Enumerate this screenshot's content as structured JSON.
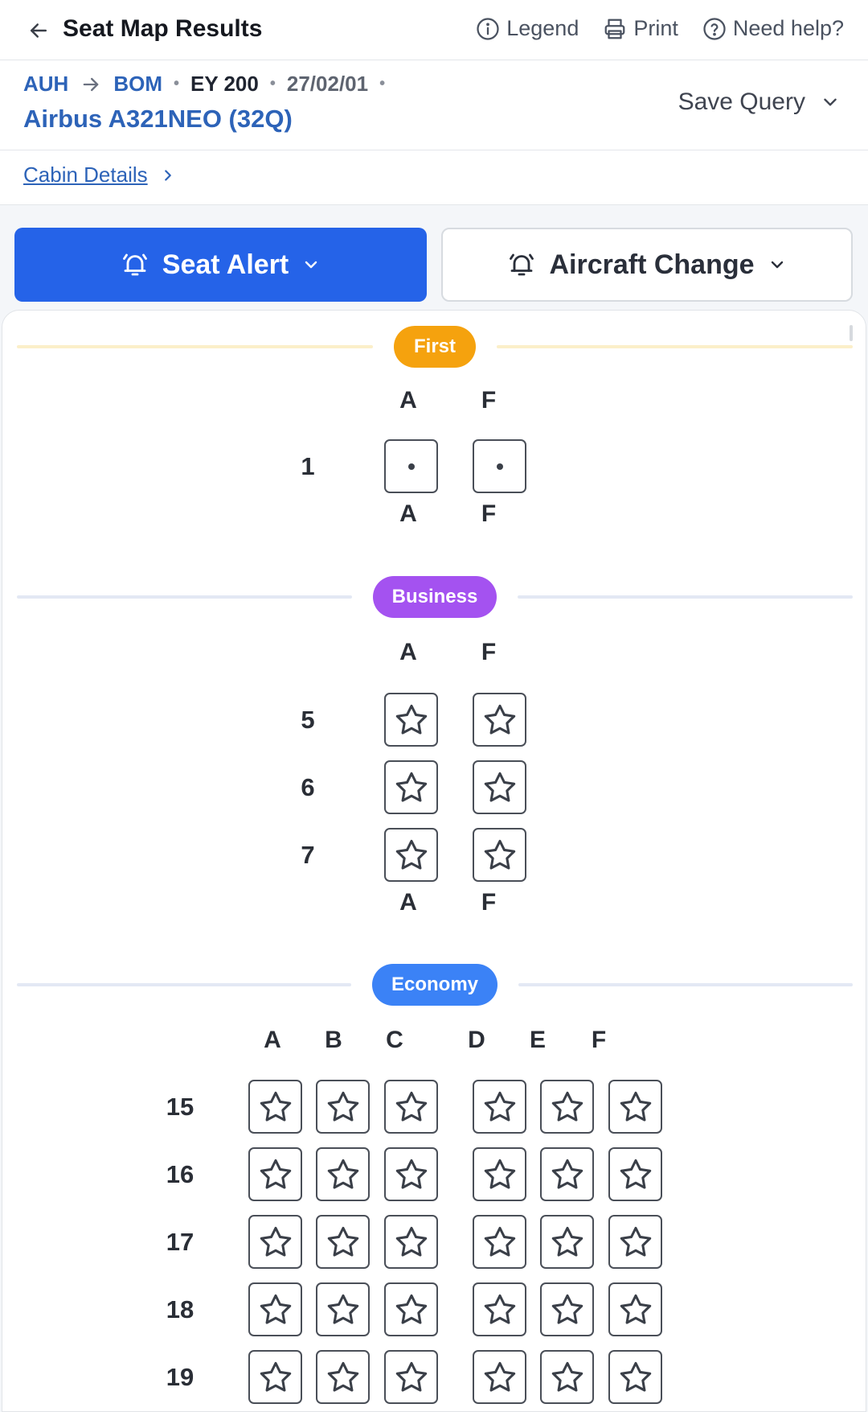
{
  "header": {
    "title": "Seat Map Results",
    "links": [
      {
        "label": "Legend",
        "icon": "info-circle-icon"
      },
      {
        "label": "Print",
        "icon": "printer-icon"
      },
      {
        "label": "Need help?",
        "icon": "question-circle-icon"
      }
    ]
  },
  "route": {
    "origin": "AUH",
    "destination": "BOM",
    "flight": "EY 200",
    "date": "27/02/01",
    "aircraft": "Airbus A321NEO (32Q)",
    "save_query": "Save Query"
  },
  "cabin_details": "Cabin Details",
  "actions": {
    "seat_alert": "Seat Alert",
    "aircraft_change": "Aircraft Change"
  },
  "colors": {
    "primary": "#2563e8",
    "link": "#2d63b8",
    "first": "#f5a20e",
    "business": "#a452f0",
    "economy": "#3b82f6"
  },
  "cabins": [
    {
      "name": "First",
      "columns": [
        "A",
        "F"
      ],
      "rows": [
        {
          "number": "1",
          "seats": [
            "dot",
            "dot"
          ]
        }
      ]
    },
    {
      "name": "Business",
      "columns": [
        "A",
        "F"
      ],
      "rows": [
        {
          "number": "5",
          "seats": [
            "star",
            "star"
          ]
        },
        {
          "number": "6",
          "seats": [
            "star",
            "star"
          ]
        },
        {
          "number": "7",
          "seats": [
            "star",
            "star"
          ]
        }
      ]
    },
    {
      "name": "Economy",
      "columns": [
        "A",
        "B",
        "C",
        "D",
        "E",
        "F"
      ],
      "rows": [
        {
          "number": "15",
          "seats": [
            "star",
            "star",
            "star",
            "star",
            "star",
            "star"
          ]
        },
        {
          "number": "16",
          "seats": [
            "star",
            "star",
            "star",
            "star",
            "star",
            "star"
          ]
        },
        {
          "number": "17",
          "seats": [
            "star",
            "star",
            "star",
            "star",
            "star",
            "star"
          ]
        },
        {
          "number": "18",
          "seats": [
            "star",
            "star",
            "star",
            "star",
            "star",
            "star"
          ]
        },
        {
          "number": "19",
          "seats": [
            "star",
            "star",
            "star",
            "star",
            "star",
            "star"
          ]
        }
      ]
    }
  ]
}
